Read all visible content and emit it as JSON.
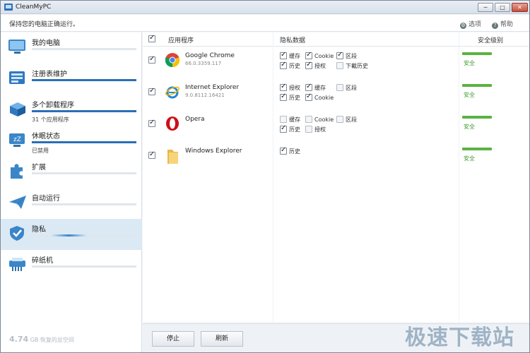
{
  "window": {
    "title": "CleanMyPC",
    "min": "─",
    "max": "□",
    "close": "✕"
  },
  "toolbar": {
    "subtitle": "保持您的电脑正确运行。",
    "options": "选项",
    "help": "帮助"
  },
  "sidebar": {
    "items": [
      {
        "label": "我的电脑",
        "icon": "monitor-icon",
        "progress": 0,
        "sub": ""
      },
      {
        "label": "注册表维护",
        "icon": "registry-icon",
        "progress": 1,
        "sub": ""
      },
      {
        "label": "多个卸载程序",
        "icon": "uninstaller-icon",
        "progress": 1,
        "sub": "31 个应用程序"
      },
      {
        "label": "休眠状态",
        "icon": "hibernation-icon",
        "progress": 1,
        "sub": "已禁用"
      },
      {
        "label": "扩展",
        "icon": "puzzle-icon",
        "progress": 0,
        "sub": ""
      },
      {
        "label": "自动运行",
        "icon": "paper-plane-icon",
        "progress": 0,
        "sub": ""
      },
      {
        "label": "隐私",
        "icon": "privacy-shield-icon",
        "progress": 0.35,
        "sub": ""
      },
      {
        "label": "碎纸机",
        "icon": "shredder-icon",
        "progress": 0,
        "sub": ""
      }
    ],
    "space": {
      "value": "4.74",
      "unit": "GB",
      "label": "恢复的总空间"
    }
  },
  "table": {
    "headers": {
      "app": "应用程序",
      "privacy": "隐私数据",
      "safety": "安全级别"
    },
    "rows": [
      {
        "name": "Google Chrome",
        "version": "66.0.3359.117",
        "icon": "chrome-icon",
        "items": [
          {
            "label": "缓存",
            "checked": true
          },
          {
            "label": "Cookie",
            "checked": true
          },
          {
            "label": "区段",
            "checked": true
          },
          {
            "label": "历史",
            "checked": true
          },
          {
            "label": "授权",
            "checked": true
          },
          {
            "label": "下載历史",
            "checked": false
          }
        ],
        "safety": "安全"
      },
      {
        "name": "Internet Explorer",
        "version": "9.0.8112.16421",
        "icon": "ie-icon",
        "items": [
          {
            "label": "授权",
            "checked": true
          },
          {
            "label": "缓存",
            "checked": true
          },
          {
            "label": "区段",
            "checked": false
          },
          {
            "label": "历史",
            "checked": true
          },
          {
            "label": "Cookie",
            "checked": true
          }
        ],
        "safety": "安全"
      },
      {
        "name": "Opera",
        "version": "",
        "icon": "opera-icon",
        "items": [
          {
            "label": "缓存",
            "checked": false
          },
          {
            "label": "Cookie",
            "checked": false
          },
          {
            "label": "区段",
            "checked": false
          },
          {
            "label": "历史",
            "checked": true
          },
          {
            "label": "授权",
            "checked": false
          }
        ],
        "safety": "安全"
      },
      {
        "name": "Windows Explorer",
        "version": "",
        "icon": "folder-icon",
        "items": [
          {
            "label": "历史",
            "checked": true
          }
        ],
        "safety": "安全"
      }
    ]
  },
  "footer": {
    "stop": "停止",
    "refresh": "刷新"
  },
  "watermark": "极速下载站",
  "colors": {
    "accent": "#2a6fb6",
    "safe": "#5ab342",
    "selected": "#dbe9f5"
  }
}
